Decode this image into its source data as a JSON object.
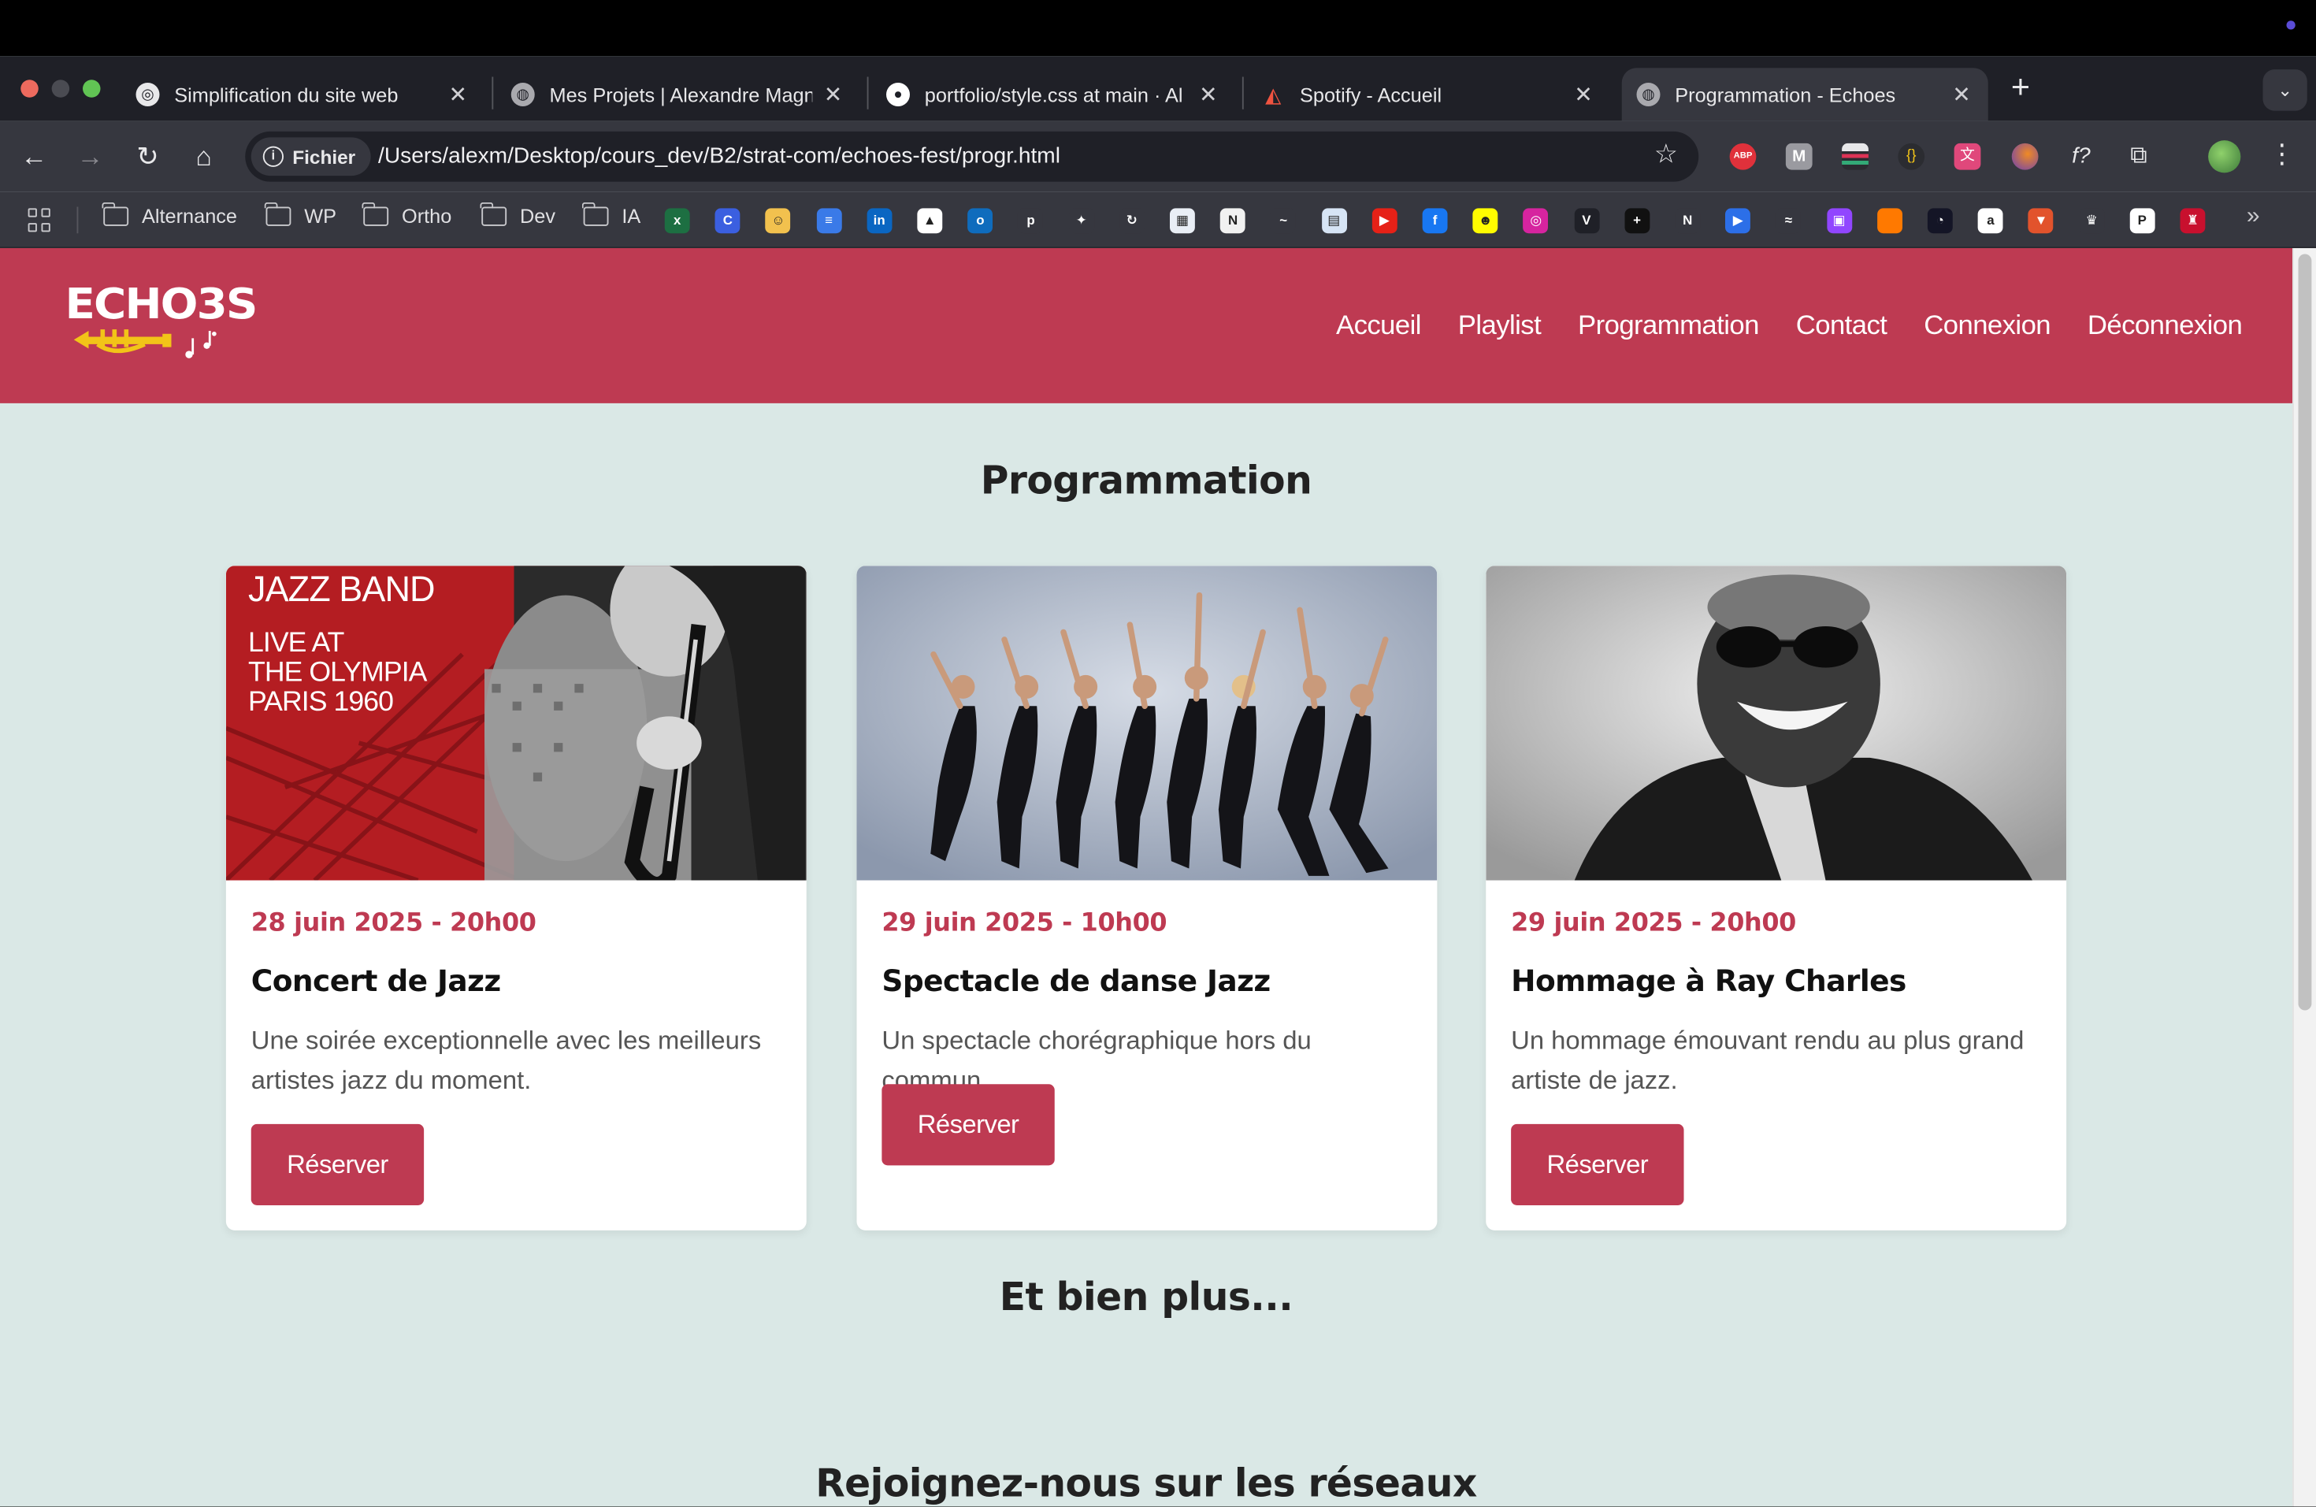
{
  "browser": {
    "tabs": [
      {
        "title": "Simplification du site web",
        "favicon": "openai-icon"
      },
      {
        "title": "Mes Projets | Alexandre Magn",
        "favicon": "globe-icon"
      },
      {
        "title": "portfolio/style.css at main · Al",
        "favicon": "github-icon"
      },
      {
        "title": "Spotify - Accueil",
        "favicon": "laravel-icon"
      },
      {
        "title": "Programmation - Echoes",
        "favicon": "globe-icon",
        "active": true
      }
    ],
    "close_glyph": "✕",
    "new_tab_glyph": "+",
    "address": {
      "chip_label": "Fichier",
      "url": "/Users/alexm/Desktop/cours_dev/B2/strat-com/echoes-fest/progr.html"
    },
    "bookmark_folders": [
      "Alternance",
      "WP",
      "Ortho",
      "Dev",
      "IA"
    ],
    "bookmark_icons": [
      {
        "name": "excel-icon",
        "color": "#1d6f42",
        "glyph": "x"
      },
      {
        "name": "canva-icon",
        "color": "#3b5fe0",
        "glyph": "C"
      },
      {
        "name": "emoji-icon",
        "color": "#f2c14e",
        "glyph": "☺"
      },
      {
        "name": "docs-icon",
        "color": "#3a7ae8",
        "glyph": "≡"
      },
      {
        "name": "linkedin-icon",
        "color": "#0a66c2",
        "glyph": "in"
      },
      {
        "name": "graduation-icon",
        "color": "#ffffff",
        "glyph": "▲"
      },
      {
        "name": "outlook-icon",
        "color": "#0f6cbd",
        "glyph": "o"
      },
      {
        "name": "pinterest-icon",
        "color": "#36373f",
        "glyph": "p"
      },
      {
        "name": "figma-icon",
        "color": "#36373f",
        "glyph": "✦"
      },
      {
        "name": "sync-icon",
        "color": "#36373f",
        "glyph": "↻"
      },
      {
        "name": "calendar-icon",
        "color": "#e9eef5",
        "glyph": "▦"
      },
      {
        "name": "notion-icon",
        "color": "#f1f1f1",
        "glyph": "N"
      },
      {
        "name": "nordvpn-icon",
        "color": "#36373f",
        "glyph": "~"
      },
      {
        "name": "drive-icon",
        "color": "#d6e4f5",
        "glyph": "▤"
      },
      {
        "name": "youtube-icon",
        "color": "#e62117",
        "glyph": "▶"
      },
      {
        "name": "facebook-icon",
        "color": "#1877f2",
        "glyph": "f"
      },
      {
        "name": "snapchat-icon",
        "color": "#fffc00",
        "glyph": "☻"
      },
      {
        "name": "instagram-icon",
        "color": "#d6249f",
        "glyph": "◎"
      },
      {
        "name": "valorant-icon",
        "color": "#1f2027",
        "glyph": "V"
      },
      {
        "name": "plus-icon",
        "color": "#111111",
        "glyph": "+"
      },
      {
        "name": "netflix-icon",
        "color": "#36373f",
        "glyph": "N"
      },
      {
        "name": "play-icon",
        "color": "#2c6fe8",
        "glyph": "▶"
      },
      {
        "name": "wave-icon",
        "color": "#36373f",
        "glyph": "≈"
      },
      {
        "name": "twitch-icon",
        "color": "#9146ff",
        "glyph": "▣"
      },
      {
        "name": "orange-icon",
        "color": "#ff7900",
        "glyph": ""
      },
      {
        "name": "speedtest-icon",
        "color": "#141526",
        "glyph": "◔"
      },
      {
        "name": "amazon-icon",
        "color": "#ffffff",
        "glyph": "a"
      },
      {
        "name": "brave-icon",
        "color": "#e2532c",
        "glyph": "▼"
      },
      {
        "name": "crown-icon",
        "color": "#36373f",
        "glyph": "♛"
      },
      {
        "name": "playstation-icon",
        "color": "#ffffff",
        "glyph": "P"
      },
      {
        "name": "shield-crest-icon",
        "color": "#c8102e",
        "glyph": "♜"
      }
    ],
    "extensions": [
      {
        "name": "adblock-icon",
        "color": "#e0313b"
      },
      {
        "name": "m-extension-icon",
        "color": "#9a9aa0"
      },
      {
        "name": "color-picker-icon",
        "color": "#2b2c31"
      },
      {
        "name": "json-icon",
        "color": "#2b2c31"
      },
      {
        "name": "translate-icon",
        "color": "#e0487b"
      },
      {
        "name": "firefox-relay-icon",
        "color": "#f08a24"
      },
      {
        "name": "font-icon",
        "color": "#36373f"
      },
      {
        "name": "puzzle-icon",
        "color": "#36373f"
      }
    ]
  },
  "site": {
    "logo_text": "ECHO3S",
    "nav": [
      "Accueil",
      "Playlist",
      "Programmation",
      "Contact",
      "Connexion",
      "Déconnexion"
    ],
    "section_title": "Programmation",
    "events": [
      {
        "date": "28 juin 2025 - 20h00",
        "title": "Concert de Jazz",
        "description": "Une soirée exceptionnelle avec les meilleurs artistes jazz du moment.",
        "button": "Réserver",
        "image_text": {
          "line1": "JAZZ BAND",
          "line2": "LIVE AT",
          "line3": "THE OLYMPIA",
          "line4": "PARIS 1960"
        }
      },
      {
        "date": "29 juin 2025 - 10h00",
        "title": "Spectacle de danse Jazz",
        "description": "Un spectacle chorégraphique hors du commun.",
        "button": "Réserver"
      },
      {
        "date": "29 juin 2025 - 20h00",
        "title": "Hommage à Ray Charles",
        "description": "Un hommage émouvant rendu au plus grand artiste de jazz.",
        "button": "Réserver"
      }
    ],
    "more_title": "Et bien plus...",
    "social_title": "Rejoignez-nous sur les réseaux"
  },
  "colors": {
    "brand": "#be3a52",
    "page_bg": "#dae8e6",
    "logo_accent": "#f2c418"
  }
}
